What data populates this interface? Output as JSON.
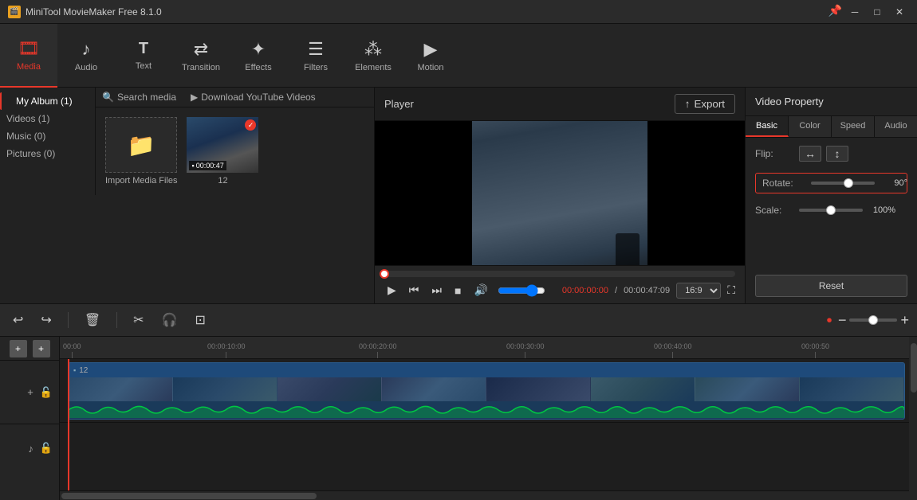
{
  "app": {
    "title": "MiniTool MovieMaker Free 8.1.0",
    "icon": "🎬"
  },
  "titlebar": {
    "controls": {
      "minimize": "─",
      "maximize": "□",
      "close": "✕"
    }
  },
  "toolbar": {
    "items": [
      {
        "id": "media",
        "label": "Media",
        "icon": "🎞",
        "active": true
      },
      {
        "id": "audio",
        "label": "Audio",
        "icon": "♪"
      },
      {
        "id": "text",
        "label": "Text",
        "icon": "T"
      },
      {
        "id": "transition",
        "label": "Transition",
        "icon": "⇄"
      },
      {
        "id": "effects",
        "label": "Effects",
        "icon": "✦"
      },
      {
        "id": "filters",
        "label": "Filters",
        "icon": "☰"
      },
      {
        "id": "elements",
        "label": "Elements",
        "icon": "⁂"
      },
      {
        "id": "motion",
        "label": "Motion",
        "icon": "▶"
      }
    ]
  },
  "left_panel": {
    "nav_items": [
      {
        "label": "My Album (1)",
        "active": true
      },
      {
        "label": "Videos (1)"
      },
      {
        "label": "Music (0)"
      },
      {
        "label": "Pictures (0)"
      }
    ],
    "search_placeholder": "Search media",
    "download_label": "Download YouTube Videos",
    "import_label": "Import Media Files",
    "media_item": {
      "name": "12",
      "timestamp": "00:00:47",
      "has_check": true
    }
  },
  "player": {
    "title": "Player",
    "export_label": "Export",
    "time_current": "00:00:00:00",
    "time_separator": " / ",
    "time_total": "00:00:47:09",
    "aspect_ratio": "16:9",
    "controls": {
      "play": "▶",
      "prev": "⏮",
      "next": "⏭",
      "stop": "■",
      "volume": "🔊"
    }
  },
  "property": {
    "title": "Video Property",
    "tabs": [
      "Basic",
      "Color",
      "Speed",
      "Audio"
    ],
    "active_tab": "Basic",
    "flip_h": "↔",
    "flip_v": "↕",
    "rotate_label": "Rotate:",
    "rotate_value": "90°",
    "rotate_percent": 60,
    "scale_label": "Scale:",
    "scale_value": "100%",
    "scale_percent": 50,
    "flip_label": "Flip:",
    "reset_label": "Reset"
  },
  "bottom_controls": {
    "undo": "↩",
    "redo": "↪",
    "delete": "🗑",
    "cut": "✂",
    "audio_detach": "🎧",
    "crop": "⊡",
    "zoom_minus": "−",
    "zoom_plus": "+"
  },
  "timeline": {
    "ruler_marks": [
      {
        "time": "00:00",
        "pos": 0
      },
      {
        "time": "00:00:10:00",
        "pos": 170
      },
      {
        "time": "00:00:20:00",
        "pos": 360
      },
      {
        "time": "00:00:30:00",
        "pos": 548
      },
      {
        "time": "00:00:40:00",
        "pos": 736
      },
      {
        "time": "00:00:50",
        "pos": 924
      }
    ],
    "video_clip_name": "12",
    "add_track_label": "+"
  }
}
